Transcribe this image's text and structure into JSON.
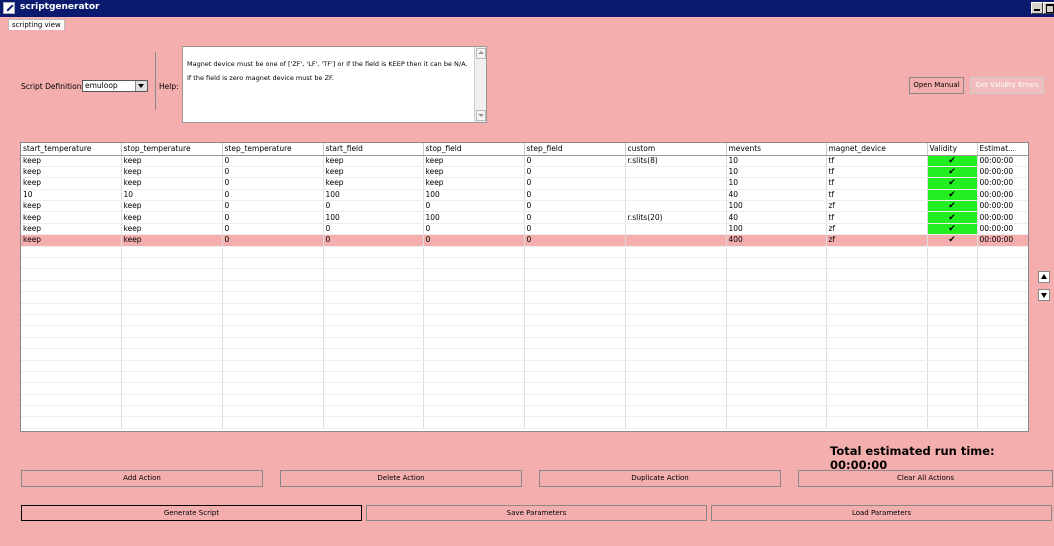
{
  "window": {
    "title": "scriptgenerator"
  },
  "tab": "scripting view",
  "script_definition": {
    "label": "Script Definition:",
    "value": "emuloop"
  },
  "help": {
    "label": "Help:",
    "line1": "Magnet device must be one of ['ZF', 'LF', 'TF'] or if the field is KEEP then it can be N/A.",
    "line2": "If the field is zero magnet device must be ZF."
  },
  "buttons": {
    "open_manual": "Open Manual",
    "get_validity_errors": "Get Validity Errors",
    "add_action": "Add Action",
    "delete_action": "Delete Action",
    "duplicate_action": "Duplicate Action",
    "clear_all_actions": "Clear All Actions",
    "generate_script": "Generate Script",
    "save_parameters": "Save Parameters",
    "load_parameters": "Load Parameters"
  },
  "table": {
    "columns": [
      "start_temperature",
      "stop_temperature",
      "step_temperature",
      "start_field",
      "stop_field",
      "step_field",
      "custom",
      "mevents",
      "magnet_device",
      "Validity",
      "Estimat..."
    ],
    "rows": [
      [
        "keep",
        "keep",
        "0",
        "keep",
        "keep",
        "0",
        "r.slits(8)",
        "10",
        "tf",
        "✔",
        "00:00:00"
      ],
      [
        "keep",
        "keep",
        "0",
        "keep",
        "keep",
        "0",
        "",
        "10",
        "tf",
        "✔",
        "00:00:00"
      ],
      [
        "keep",
        "keep",
        "0",
        "keep",
        "keep",
        "0",
        "",
        "10",
        "tf",
        "✔",
        "00:00:00"
      ],
      [
        "10",
        "10",
        "0",
        "100",
        "100",
        "0",
        "",
        "40",
        "tf",
        "✔",
        "00:00:00"
      ],
      [
        "keep",
        "keep",
        "0",
        "0",
        "0",
        "0",
        "",
        "100",
        "zf",
        "✔",
        "00:00:00"
      ],
      [
        "keep",
        "keep",
        "0",
        "100",
        "100",
        "0",
        "r.slits(20)",
        "40",
        "tf",
        "✔",
        "00:00:00"
      ],
      [
        "keep",
        "keep",
        "0",
        "0",
        "0",
        "0",
        "",
        "100",
        "zf",
        "✔",
        "00:00:00"
      ],
      [
        "keep",
        "keep",
        "0",
        "0",
        "0",
        "0",
        "",
        "400",
        "zf",
        "✔",
        "00:00:00"
      ]
    ],
    "selected_row": 7
  },
  "total_run_time": "Total estimated run time: 00:00:00",
  "colors": {
    "background": "#f5aeae",
    "valid": "#22ee22",
    "titlebar": "#0a1a6e"
  }
}
